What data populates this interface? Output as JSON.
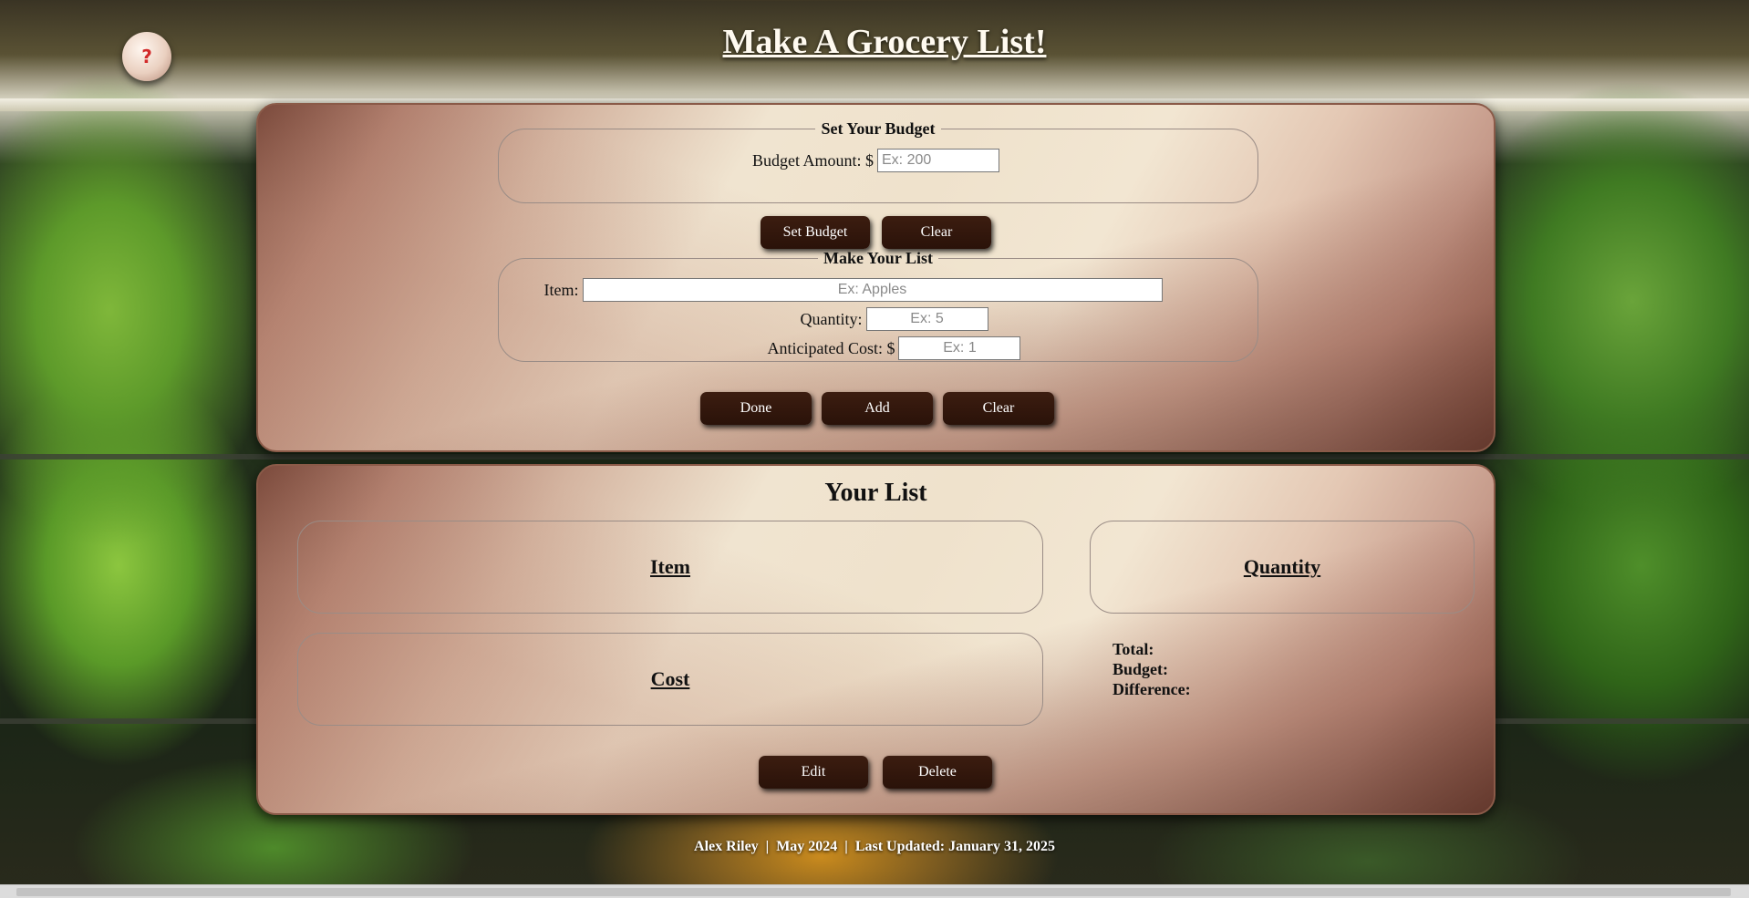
{
  "header": {
    "help_label": "?",
    "title": "Make A Grocery List!"
  },
  "budget_section": {
    "legend": "Set Your Budget",
    "amount_label": "Budget Amount: $",
    "amount_placeholder": "Ex: 200",
    "set_button": "Set Budget",
    "clear_button": "Clear"
  },
  "list_section": {
    "legend": "Make Your List",
    "item_label": "Item:",
    "item_placeholder": "Ex: Apples",
    "quantity_label": "Quantity:",
    "quantity_placeholder": "Ex: 5",
    "cost_label": "Anticipated Cost: $",
    "cost_placeholder": "Ex: 1",
    "done_button": "Done",
    "add_button": "Add",
    "clear_button": "Clear"
  },
  "your_list": {
    "heading": "Your List",
    "item_header": "Item",
    "quantity_header": "Quantity",
    "cost_header": "Cost",
    "total_label": "Total:",
    "budget_label": "Budget:",
    "difference_label": "Difference:",
    "edit_button": "Edit",
    "delete_button": "Delete"
  },
  "footer": {
    "text": "Alex Riley  |  May 2024  |  Last Updated: January 31, 2025"
  },
  "colors": {
    "button_bg": "#2e140a",
    "title_text": "#fffaf0",
    "help_icon": "#d22a2a"
  }
}
